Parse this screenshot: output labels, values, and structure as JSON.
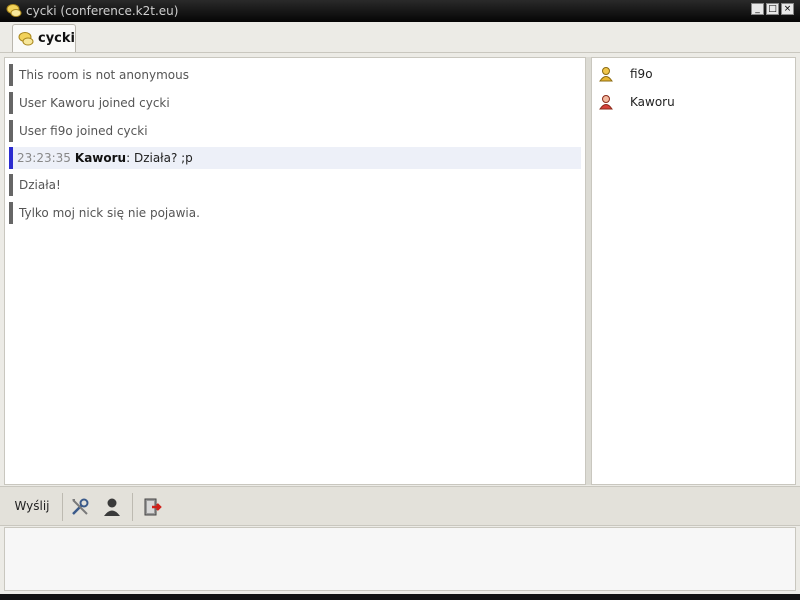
{
  "window": {
    "title": "cycki (conference.k2t.eu)",
    "controls": [
      "_",
      "□",
      "×"
    ]
  },
  "tabs": [
    {
      "label": "cycki",
      "icon": "group-chat-icon"
    }
  ],
  "messages": [
    {
      "text": "This room is not anonymous"
    },
    {
      "text": "User Kaworu joined cycki"
    },
    {
      "text": "User fi9o joined cycki"
    },
    {
      "timestamp": "23:23:35",
      "nick": "Kaworu",
      "text": ": Działa? ;p",
      "highlight": true
    },
    {
      "text": "Działa!"
    },
    {
      "text": "Tylko moj nick się nie pojawia."
    }
  ],
  "roster": [
    {
      "name": "fi9o",
      "icon": "user-yellow-icon"
    },
    {
      "name": "Kaworu",
      "icon": "user-red-icon"
    }
  ],
  "toolbar": {
    "send_label": "Wyślij",
    "tools": [
      "settings-tools-icon",
      "contact-info-icon",
      "leave-room-icon"
    ]
  },
  "input": {
    "value": ""
  },
  "colors": {
    "highlight_bar": "#2b2bcf",
    "message_bar": "#666666",
    "titlebar": "#0a0a0a"
  }
}
